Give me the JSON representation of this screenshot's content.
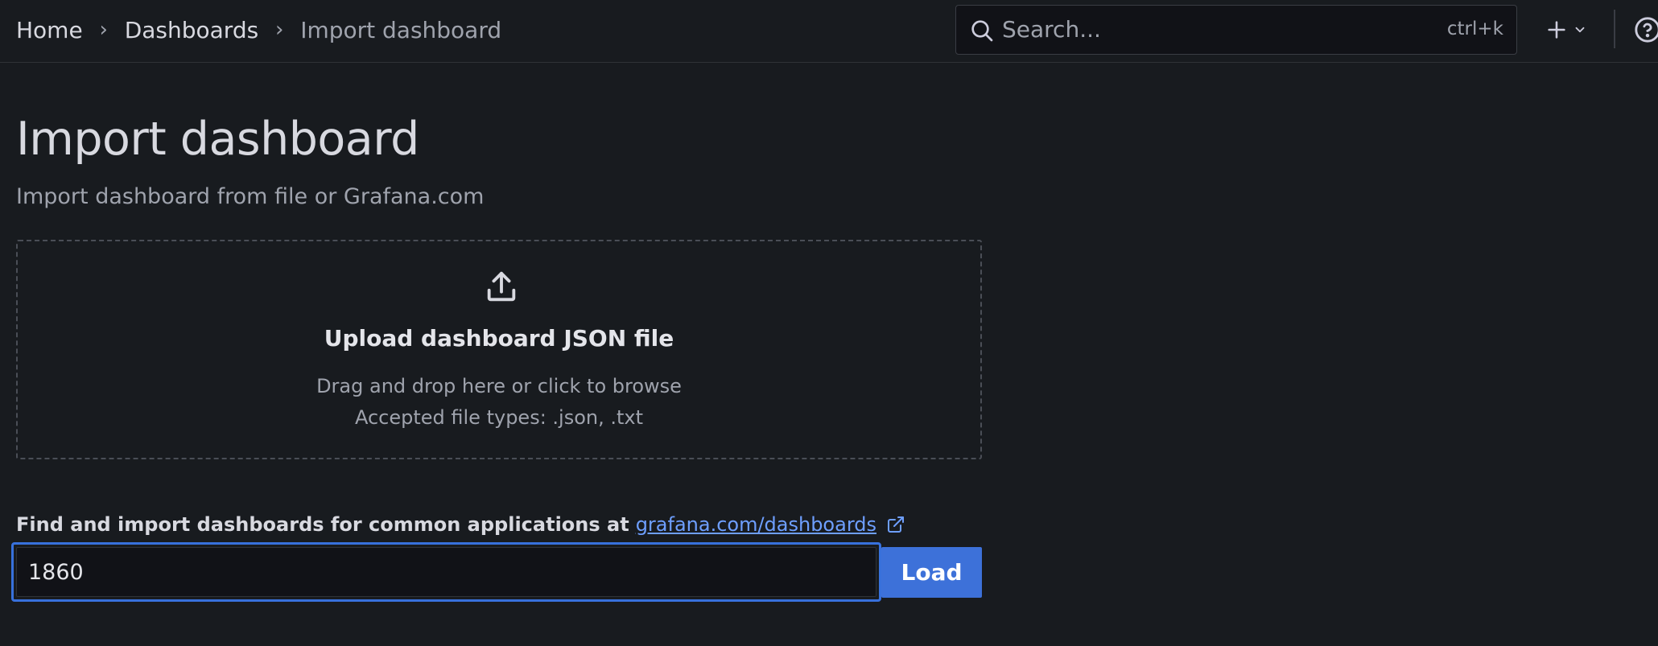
{
  "breadcrumb": {
    "items": [
      {
        "label": "Home"
      },
      {
        "label": "Dashboards"
      },
      {
        "label": "Import dashboard"
      }
    ],
    "separator": "›"
  },
  "search": {
    "placeholder": "Search...",
    "shortcut": "ctrl+k"
  },
  "header": {
    "add_icon": "plus-icon",
    "chevron_icon": "chevron-down-icon",
    "help_icon": "help-circle-icon"
  },
  "page": {
    "title": "Import dashboard",
    "subtitle": "Import dashboard from file or Grafana.com"
  },
  "upload": {
    "icon": "upload-icon",
    "title": "Upload dashboard JSON file",
    "hint": "Drag and drop here or click to browse",
    "accepted": "Accepted file types: .json, .txt"
  },
  "grafana_com": {
    "label": "Find and import dashboards for common applications at",
    "link_text": "grafana.com/dashboards",
    "link_icon": "external-link-icon",
    "input_value": "1860",
    "load_button": "Load"
  },
  "colors": {
    "background": "#181b1f",
    "accent": "#3d71d9",
    "link": "#6e9fff"
  }
}
